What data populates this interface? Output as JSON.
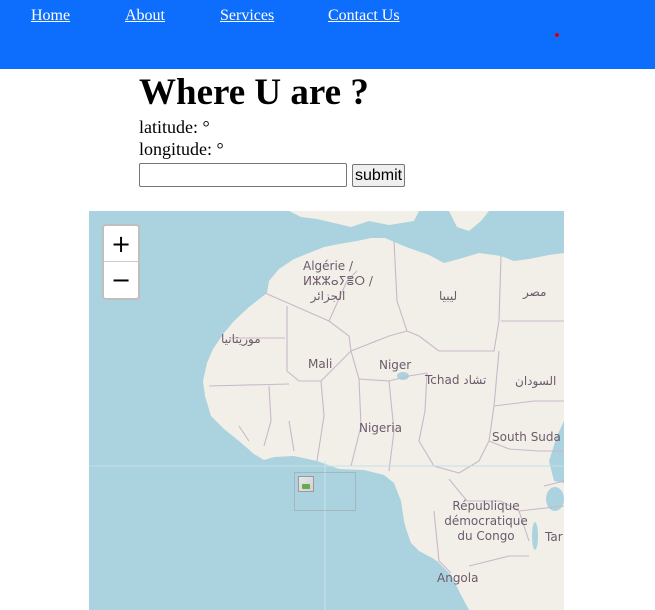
{
  "nav": {
    "items": [
      {
        "label": "Home"
      },
      {
        "label": "About"
      },
      {
        "label": "Services"
      },
      {
        "label": "Contact Us"
      }
    ]
  },
  "colors": {
    "navbar": "#0d6efd",
    "sea": "#aad3df",
    "land": "#f2efe9"
  },
  "page": {
    "title": "Where U are ?",
    "latitude_label": "latitude: °",
    "longitude_label": "longitude: °"
  },
  "form": {
    "input_value": "",
    "input_placeholder": "",
    "submit_label": "submit"
  },
  "map": {
    "zoom_in": "+",
    "zoom_out": "−",
    "marker_image": "broken-image-icon",
    "labels": {
      "algeria_1": "Algérie /",
      "algeria_2": "ⵍⵣⵣⴰⵢⴻⵔ /",
      "algeria_3": "الجزائر",
      "libya": "ليبيا",
      "egypt": "مصر",
      "mauritania": "موريتانيا",
      "mali": "Mali",
      "niger": "Niger",
      "chad": "Tchad تشاد",
      "sudan": "السودان",
      "nigeria": "Nigeria",
      "south_sudan": "South Suda",
      "drc_1": "République",
      "drc_2": "démocratique",
      "drc_3": "du Congo",
      "tanzania": "Tar",
      "angola": "Angola"
    }
  }
}
